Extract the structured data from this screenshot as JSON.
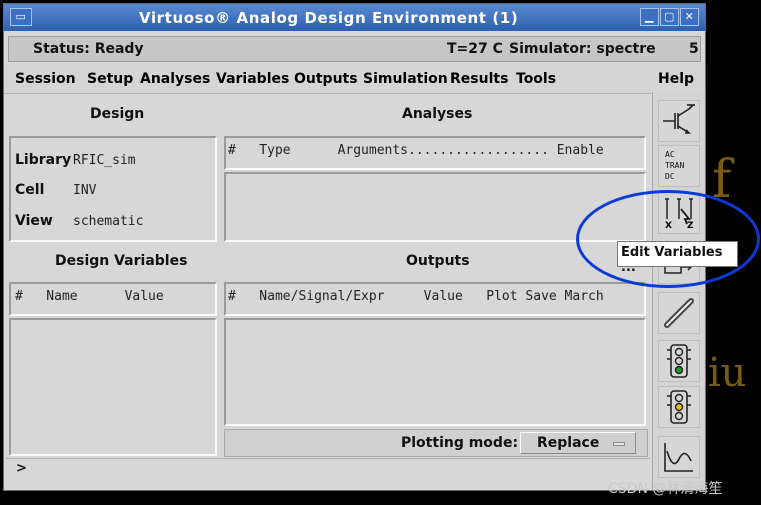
{
  "window": {
    "title": "Virtuoso® Analog Design Environment (1)"
  },
  "titlebar_icons": [
    "minimize-icon",
    "maximize-icon",
    "close-icon"
  ],
  "status": {
    "text": "Status: Ready",
    "temp": "T=27  C",
    "simulator": "Simulator: spectre",
    "count": "5"
  },
  "menu": {
    "items": [
      "Session",
      "Setup",
      "Analyses",
      "Variables",
      "Outputs",
      "Simulation",
      "Results",
      "Tools"
    ],
    "help": "Help"
  },
  "design": {
    "title": "Design",
    "rows": [
      {
        "label": "Library",
        "value": "RFIC_sim"
      },
      {
        "label": "Cell",
        "value": "INV"
      },
      {
        "label": "View",
        "value": "schematic"
      }
    ]
  },
  "analyses": {
    "title": "Analyses",
    "header": "#   Type      Arguments.................. Enable"
  },
  "design_variables": {
    "title": "Design Variables",
    "header": "#   Name      Value"
  },
  "outputs": {
    "title": "Outputs",
    "header": "#   Name/Signal/Expr     Value   Plot Save March"
  },
  "plotting": {
    "label": "Plotting mode:",
    "value": "Replace"
  },
  "command_prompt": ">",
  "toolbar": {
    "analysis_labels": [
      "AC",
      "TRAN",
      "DC"
    ],
    "var_labels": [
      "X",
      "Z"
    ],
    "tooltip": "Edit Variables ..."
  },
  "watermark": "CSDN @林清海笙"
}
